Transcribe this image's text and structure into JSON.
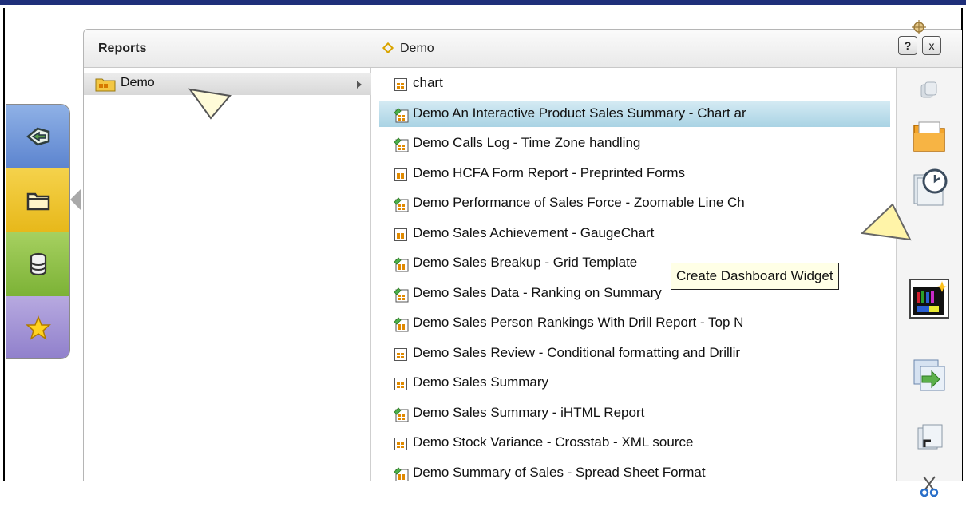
{
  "panel": {
    "reports_title": "Reports",
    "current_folder": "Demo",
    "help_label": "?",
    "close_label": "x"
  },
  "folders": [
    {
      "label": "Demo",
      "icon": "folder-icon",
      "selected": true
    }
  ],
  "files": [
    {
      "label": "chart",
      "icon": "report-icon",
      "selected": false
    },
    {
      "label": "Demo An Interactive Product Sales Summary - Chart ar",
      "icon": "interactive-report-icon",
      "selected": true
    },
    {
      "label": "Demo Calls Log - Time Zone handling",
      "icon": "interactive-report-icon",
      "selected": false
    },
    {
      "label": "Demo HCFA Form Report - Preprinted Forms",
      "icon": "report-icon",
      "selected": false
    },
    {
      "label": "Demo Performance of Sales Force - Zoomable Line Ch",
      "icon": "interactive-report-icon",
      "selected": false
    },
    {
      "label": "Demo Sales Achievement - GaugeChart",
      "icon": "report-icon",
      "selected": false
    },
    {
      "label": "Demo Sales Breakup - Grid Template",
      "icon": "interactive-report-icon",
      "selected": false
    },
    {
      "label": "Demo Sales Data - Ranking on Summary",
      "icon": "interactive-report-icon",
      "selected": false
    },
    {
      "label": "Demo Sales Person Rankings With Drill Report - Top N",
      "icon": "interactive-report-icon",
      "selected": false
    },
    {
      "label": "Demo Sales Review - Conditional formatting and Drillir",
      "icon": "report-icon",
      "selected": false
    },
    {
      "label": "Demo Sales Summary",
      "icon": "report-icon",
      "selected": false
    },
    {
      "label": "Demo Sales Summary - iHTML Report",
      "icon": "interactive-report-icon",
      "selected": false
    },
    {
      "label": "Demo Stock Variance - Crosstab - XML source",
      "icon": "report-icon",
      "selected": false
    },
    {
      "label": "Demo Summary of Sales - Spread Sheet Format",
      "icon": "interactive-report-icon",
      "selected": false
    }
  ],
  "tooltip": {
    "text": "Create Dashboard Widget"
  },
  "rail_tabs": [
    {
      "icon": "back-arrow-icon"
    },
    {
      "icon": "folder-open-icon"
    },
    {
      "icon": "database-icon"
    },
    {
      "icon": "star-icon"
    }
  ],
  "toolbar_buttons": [
    {
      "icon": "copy-icon"
    },
    {
      "icon": "open-folder-icon"
    },
    {
      "icon": "schedule-clock-icon"
    },
    {
      "icon": "dashboard-widget-icon",
      "active": true
    },
    {
      "icon": "export-icon"
    },
    {
      "icon": "shortcut-icon"
    },
    {
      "icon": "scissors-icon"
    }
  ],
  "colors": {
    "selection": "#a9d3e4",
    "top_rule": "#1f2f7a",
    "tooltip_bg": "#ffffe6"
  }
}
